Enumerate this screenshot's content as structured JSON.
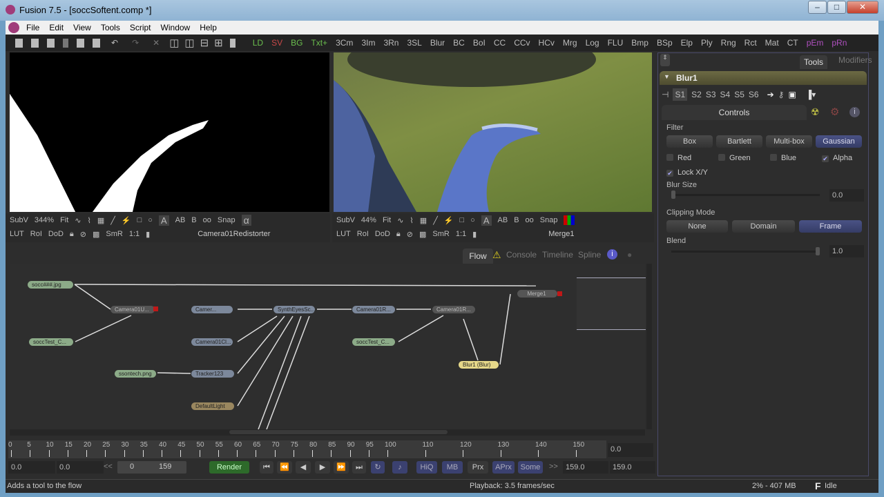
{
  "window": {
    "title": "Fusion 7.5 - [soccSoftent.comp *]",
    "minimize": "–",
    "maximize": "□",
    "close": "✕"
  },
  "menu": [
    "File",
    "Edit",
    "View",
    "Tools",
    "Script",
    "Window",
    "Help"
  ],
  "toolbar_tools": [
    {
      "label": "LD",
      "color": "#6bbf4e"
    },
    {
      "label": "SV",
      "color": "#c84848"
    },
    {
      "label": "BG",
      "color": "#6bbf4e"
    },
    {
      "label": "Txt+",
      "color": "#6bbf4e"
    },
    {
      "label": "3Cm",
      "color": "#bbb"
    },
    {
      "label": "3Im",
      "color": "#bbb"
    },
    {
      "label": "3Rn",
      "color": "#bbb"
    },
    {
      "label": "3SL",
      "color": "#bbb"
    },
    {
      "label": "Blur",
      "color": "#bbb"
    },
    {
      "label": "BC",
      "color": "#bbb"
    },
    {
      "label": "BoI",
      "color": "#bbb"
    },
    {
      "label": "CC",
      "color": "#bbb"
    },
    {
      "label": "CCv",
      "color": "#bbb"
    },
    {
      "label": "HCv",
      "color": "#bbb"
    },
    {
      "label": "Mrg",
      "color": "#bbb"
    },
    {
      "label": "Log",
      "color": "#bbb"
    },
    {
      "label": "FLU",
      "color": "#bbb"
    },
    {
      "label": "Bmp",
      "color": "#bbb"
    },
    {
      "label": "BSp",
      "color": "#bbb"
    },
    {
      "label": "Elp",
      "color": "#bbb"
    },
    {
      "label": "Ply",
      "color": "#bbb"
    },
    {
      "label": "Rng",
      "color": "#bbb"
    },
    {
      "label": "Rct",
      "color": "#bbb"
    },
    {
      "label": "Mat",
      "color": "#bbb"
    },
    {
      "label": "CT",
      "color": "#bbb"
    },
    {
      "label": "pEm",
      "color": "#b050c0"
    },
    {
      "label": "pRn",
      "color": "#b050c0"
    }
  ],
  "viewer_left": {
    "subv": "SubV",
    "zoom": "344%",
    "fit": "Fit",
    "a": "A",
    "ab": "AB",
    "b": "B",
    "snap": "Snap",
    "alpha": "α",
    "lut": "LUT",
    "roi": "RoI",
    "dod": "DoD",
    "smr": "SmR",
    "ratio": "1:1",
    "name": "Camera01Redistorter"
  },
  "viewer_right": {
    "subv": "SubV",
    "zoom": "44%",
    "fit": "Fit",
    "a": "A",
    "ab": "AB",
    "b": "B",
    "snap": "Snap",
    "lut": "LUT",
    "roi": "RoI",
    "dod": "DoD",
    "smr": "SmR",
    "ratio": "1:1",
    "name": "Merge1"
  },
  "flow_tabs": [
    "Flow",
    "Console",
    "Timeline",
    "Spline"
  ],
  "nodes": [
    "socc###.jpg",
    "Camera01U...",
    "soccTest_C...",
    "Camer...",
    "Camera01Cl...",
    "ssontech.png",
    "Tracker123",
    "DefaultLight",
    "SynthEyesSc...",
    "Camera01R...",
    "soccTest_C...",
    "Camera01R...",
    "Blur1  (Blur)",
    "Merge1"
  ],
  "right_tabs": {
    "tools": "Tools",
    "modifiers": "Modifiers"
  },
  "tool": {
    "name": "Blur1",
    "slots": [
      "S1",
      "S2",
      "S3",
      "S4",
      "S5",
      "S6"
    ],
    "controls_tab": "Controls",
    "filter_label": "Filter",
    "filters": [
      "Box",
      "Bartlett",
      "Multi-box",
      "Gaussian"
    ],
    "filter_selected": "Gaussian",
    "channels": [
      {
        "label": "Red",
        "checked": false
      },
      {
        "label": "Green",
        "checked": false
      },
      {
        "label": "Blue",
        "checked": false
      },
      {
        "label": "Alpha",
        "checked": true
      }
    ],
    "lock_xy": {
      "label": "Lock X/Y",
      "checked": true
    },
    "blur_size": {
      "label": "Blur Size",
      "value": "0.0"
    },
    "clipping": {
      "label": "Clipping Mode",
      "options": [
        "None",
        "Domain",
        "Frame"
      ],
      "selected": "Frame"
    },
    "blend": {
      "label": "Blend",
      "value": "1.0"
    }
  },
  "timeline": {
    "ticks": [
      0,
      5,
      10,
      15,
      20,
      25,
      30,
      35,
      40,
      45,
      50,
      55,
      60,
      65,
      70,
      75,
      80,
      85,
      90,
      95,
      100,
      110,
      120,
      130,
      140,
      150
    ],
    "current": "0.0",
    "start": "0.0",
    "global_start": "0.0",
    "range_start": "0",
    "range_end": "159",
    "end": "159.0",
    "global_end": "159.0",
    "prev": "<<",
    "next": ">>"
  },
  "transport": {
    "render": "Render",
    "hiq": "HiQ",
    "mb": "MB",
    "prx": "Prx",
    "aprx": "APrx",
    "some": "Some"
  },
  "status": {
    "hint": "Adds a tool to the flow",
    "playback": "Playback: 3.5 frames/sec",
    "memory": "2% -  407 MB",
    "state": "Idle",
    "state_icon": "F"
  }
}
